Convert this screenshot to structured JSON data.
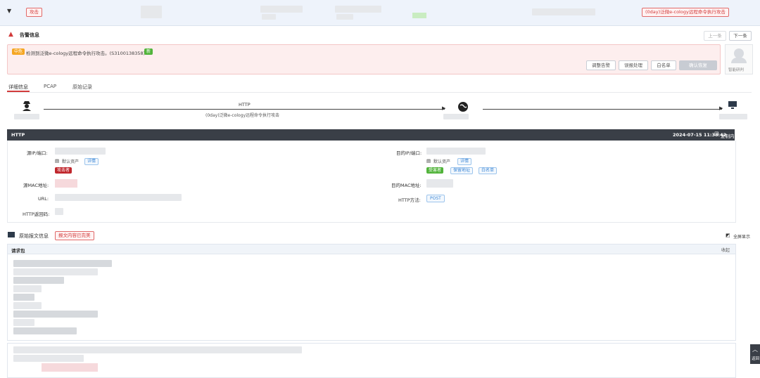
{
  "topbar": {
    "attack_tag": "攻击",
    "event_name": "(0day)泛微e-cology远程命令执行攻击"
  },
  "alert_section": {
    "title": "告警信息",
    "prev_label": "上一条",
    "next_label": "下一条",
    "severity": "中危",
    "description": "检测到泛微e-cology远程命令执行攻击。(S3100138358)",
    "new_badge": "新",
    "actions": [
      "调整告警",
      "误报处理",
      "白名单",
      "确认恢复"
    ],
    "assign_label": "智能研判"
  },
  "tabs": [
    {
      "label": "详细信息",
      "active": true
    },
    {
      "label": "PCAP",
      "active": false
    },
    {
      "label": "原始记录",
      "active": false
    }
  ],
  "flow": {
    "protocol": "HTTP",
    "attack_name": "(0day)泛微e-cology远程命令执行攻击"
  },
  "http_panel": {
    "title": "HTTP",
    "timestamp": "2024-07-15 11:38:42",
    "copy_label": "复制内容",
    "src_label": "源IP/端口:",
    "src_asset": "默认资产",
    "src_detail_link": "详情",
    "src_role": "攻击者",
    "src_mac_label": "源MAC地址:",
    "url_label": "URL:",
    "status_label": "HTTP返回码:",
    "dst_label": "目的IP/端口:",
    "dst_asset": "默认资产",
    "dst_detail_link": "详情",
    "dst_role": "受害者",
    "dst_tags": [
      "保留地址",
      "白名单"
    ],
    "dst_mac_label": "目的MAC地址:",
    "method_label": "HTTP方法:",
    "method_value": "POST"
  },
  "raw_section": {
    "title": "原始报文信息",
    "warning": "报文内容已完美",
    "fullscreen_label": "全屏显示",
    "request_label": "请求包",
    "collapse_label": "收起",
    "back_top_label": "返回"
  },
  "colors": {
    "accent_red": "#d23b3b",
    "dark_bar": "#3a3f47",
    "green": "#52b43b",
    "link_blue": "#3b86d6"
  }
}
